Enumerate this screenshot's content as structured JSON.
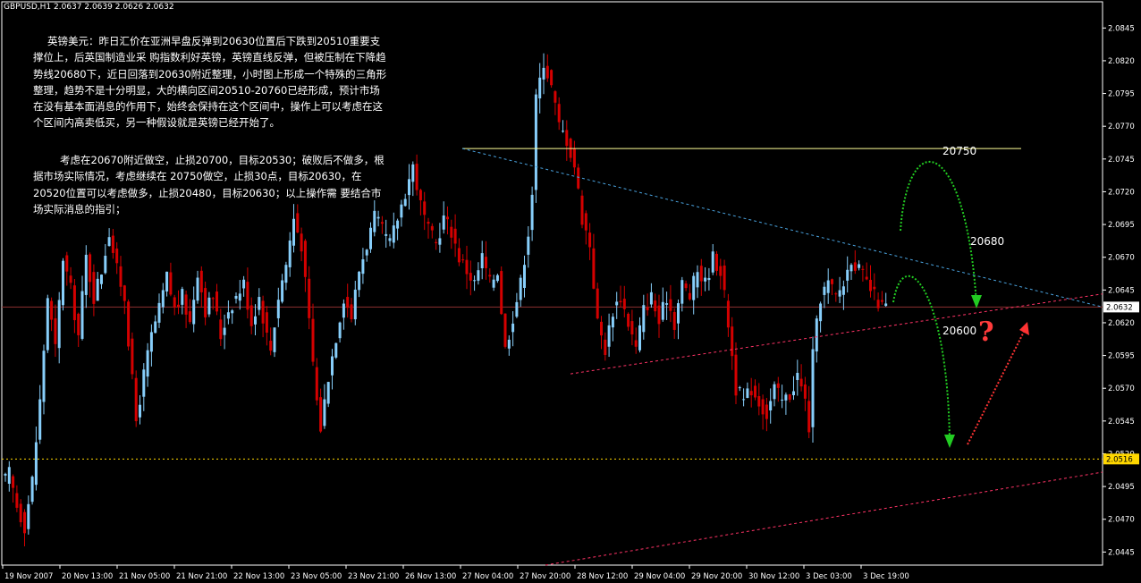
{
  "header": {
    "symbol_line": "GBPUSD,H1  2.0637 2.0639 2.0626 2.0632"
  },
  "notes": {
    "paragraph1": "英镑美元：昨日汇价在亚洲早盘反弹到20630位置后下跌到20510重要支撑位上，后英国制造业采 购指数利好英镑，英镑直线反弹，但被压制在下降趋势线20680下，近日回落到20630附近整理，小时图上形成一个特殊的三角形整理，趋势不是十分明显，大的横向区间20510-20760已经形成，预计市场 在没有基本面消息的作用下，始终会保持在这个区间中，操作上可以考虑在这个区间内高卖低买，另一种假设就是英镑已经开始了。",
    "paragraph2": "考虑在20670附近做空，止损20700，目标20530；破败后不做多，根据市场实际情况，考虑继续在 20750做空，止损30点，目标20630，在20520位置可以考虑做多，止损20480，目标20630；以上操作需 要结合市场实际消息的指引；"
  },
  "annotations": {
    "level_20750": "20750",
    "level_20680": "20680",
    "level_20600": "20600",
    "question": "?"
  },
  "chart_data": {
    "type": "candlestick",
    "symbol": "GBPUSD",
    "timeframe": "H1",
    "ohlc_header": {
      "open": 2.0637,
      "high": 2.0639,
      "low": 2.0626,
      "close": 2.0632
    },
    "y_ticks": [
      2.0445,
      2.047,
      2.0495,
      2.052,
      2.0545,
      2.057,
      2.0595,
      2.062,
      2.0645,
      2.067,
      2.0695,
      2.072,
      2.0745,
      2.077,
      2.0795,
      2.082,
      2.0845
    ],
    "y_tick_labels": [
      "2.0445",
      "2.0470",
      "2.0495",
      "2.0520",
      "2.0545",
      "2.0570",
      "2.0595",
      "2.0620",
      "2.0645",
      "2.0670",
      "2.0695",
      "2.0720",
      "2.0745",
      "2.0770",
      "2.0795",
      "2.0820",
      "2.0845"
    ],
    "ylim": [
      2.0435,
      2.0865
    ],
    "x_tick_labels": [
      "19 Nov 2007",
      "20 Nov 13:00",
      "21 Nov 05:00",
      "21 Nov 21:00",
      "22 Nov 13:00",
      "23 Nov 05:00",
      "23 Nov 21:00",
      "26 Nov 13:00",
      "27 Nov 04:00",
      "27 Nov 20:00",
      "28 Nov 12:00",
      "29 Nov 04:00",
      "29 Nov 20:00",
      "30 Nov 12:00",
      "3 Dec 03:00",
      "3 Dec 19:00"
    ],
    "current_price": {
      "value": 2.0632,
      "label": "2.0632"
    },
    "support_price": {
      "value": 2.0516,
      "label": "2.0516"
    },
    "anchors": [
      [
        0,
        2.05
      ],
      [
        1,
        2.0505
      ],
      [
        3,
        2.048
      ],
      [
        5,
        2.0465
      ],
      [
        7,
        2.05
      ],
      [
        9,
        2.056
      ],
      [
        11,
        2.064
      ],
      [
        13,
        2.06
      ],
      [
        15,
        2.067
      ],
      [
        17,
        2.0645
      ],
      [
        19,
        2.061
      ],
      [
        21,
        2.067
      ],
      [
        23,
        2.064
      ],
      [
        25,
        2.066
      ],
      [
        27,
        2.069
      ],
      [
        29,
        2.066
      ],
      [
        31,
        2.064
      ],
      [
        33,
        2.0575
      ],
      [
        34,
        2.0545
      ],
      [
        36,
        2.058
      ],
      [
        38,
        2.061
      ],
      [
        40,
        2.063
      ],
      [
        42,
        2.0655
      ],
      [
        44,
        2.063
      ],
      [
        46,
        2.064
      ],
      [
        48,
        2.062
      ],
      [
        50,
        2.066
      ],
      [
        52,
        2.063
      ],
      [
        54,
        2.064
      ],
      [
        56,
        2.061
      ],
      [
        58,
        2.063
      ],
      [
        60,
        2.064
      ],
      [
        62,
        2.065
      ],
      [
        64,
        2.062
      ],
      [
        66,
        2.064
      ],
      [
        68,
        2.061
      ],
      [
        69,
        2.06
      ],
      [
        71,
        2.064
      ],
      [
        73,
        2.0665
      ],
      [
        75,
        2.07
      ],
      [
        77,
        2.068
      ],
      [
        79,
        2.062
      ],
      [
        81,
        2.056
      ],
      [
        82,
        2.054
      ],
      [
        84,
        2.058
      ],
      [
        86,
        2.061
      ],
      [
        88,
        2.064
      ],
      [
        90,
        2.0625
      ],
      [
        92,
        2.066
      ],
      [
        94,
        2.068
      ],
      [
        96,
        2.07
      ],
      [
        98,
        2.069
      ],
      [
        100,
        2.068
      ],
      [
        102,
        2.07
      ],
      [
        104,
        2.072
      ],
      [
        106,
        2.074
      ],
      [
        108,
        2.071
      ],
      [
        110,
        2.069
      ],
      [
        112,
        2.068
      ],
      [
        114,
        2.07
      ],
      [
        116,
        2.069
      ],
      [
        118,
        2.067
      ],
      [
        120,
        2.066
      ],
      [
        122,
        2.065
      ],
      [
        124,
        2.067
      ],
      [
        126,
        2.065
      ],
      [
        128,
        2.066
      ],
      [
        130,
        2.06
      ],
      [
        132,
        2.0625
      ],
      [
        134,
        2.065
      ],
      [
        136,
        2.069
      ],
      [
        137,
        2.072
      ],
      [
        138,
        2.079
      ],
      [
        140,
        2.082
      ],
      [
        142,
        2.08
      ],
      [
        144,
        2.077
      ],
      [
        146,
        2.076
      ],
      [
        148,
        2.074
      ],
      [
        150,
        2.07
      ],
      [
        152,
        2.068
      ],
      [
        154,
        2.062
      ],
      [
        156,
        2.06
      ],
      [
        158,
        2.063
      ],
      [
        160,
        2.064
      ],
      [
        162,
        2.062
      ],
      [
        164,
        2.06
      ],
      [
        166,
        2.063
      ],
      [
        168,
        2.064
      ],
      [
        170,
        2.062
      ],
      [
        172,
        2.064
      ],
      [
        174,
        2.062
      ],
      [
        176,
        2.065
      ],
      [
        178,
        2.064
      ],
      [
        180,
        2.066
      ],
      [
        182,
        2.065
      ],
      [
        184,
        2.067
      ],
      [
        186,
        2.066
      ],
      [
        188,
        2.062
      ],
      [
        190,
        2.057
      ],
      [
        192,
        2.056
      ],
      [
        194,
        2.057
      ],
      [
        196,
        2.056
      ],
      [
        198,
        2.055
      ],
      [
        200,
        2.057
      ],
      [
        202,
        2.056
      ],
      [
        204,
        2.0565
      ],
      [
        206,
        2.058
      ],
      [
        208,
        2.056
      ],
      [
        209,
        2.054
      ],
      [
        210,
        2.0595
      ],
      [
        212,
        2.064
      ],
      [
        214,
        2.065
      ],
      [
        216,
        2.064
      ],
      [
        218,
        2.065
      ],
      [
        220,
        2.067
      ],
      [
        222,
        2.066
      ],
      [
        224,
        2.065
      ],
      [
        226,
        2.064
      ],
      [
        228,
        2.0632
      ]
    ]
  }
}
